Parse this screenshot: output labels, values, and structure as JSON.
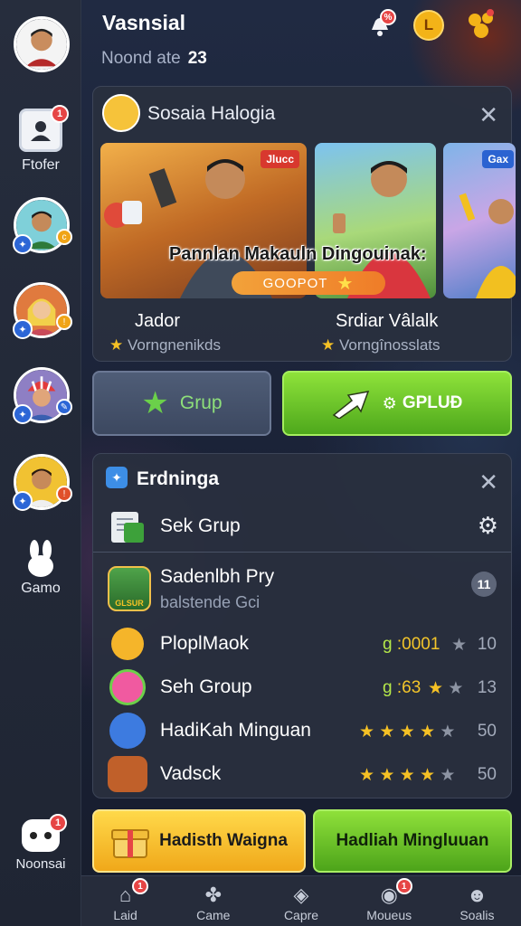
{
  "header": {
    "title": "Vasnsial",
    "subtitle_label": "Noond ate",
    "subtitle_value": "23",
    "notif_badge": "%"
  },
  "rail": {
    "items": [
      {
        "label": "Ftofer",
        "badge": "1"
      },
      {
        "label": "Gamo"
      },
      {
        "label": "Noonsai",
        "badge": "1"
      }
    ]
  },
  "featured": {
    "title": "Sosaia Halogia",
    "card1_tag": "Jlucc",
    "card3_tag": "Gax",
    "overlay_text": "Pannlan Makauln Dingouinak:",
    "badge_text": "GOOPOT",
    "captions": [
      {
        "name": "Jador",
        "sub": "Vorngnenikds"
      },
      {
        "name": "Srdiar Vâlalk",
        "sub": "Vorngînosslats"
      }
    ]
  },
  "actions": {
    "grup_label": "Grup",
    "gplup_label": "GPLUÐ"
  },
  "group_panel": {
    "title": "Erdninga",
    "sek_label": "Sek Grup",
    "rows": [
      {
        "name": "Sadenlbh Pry",
        "sub": "balstende Gci",
        "badge": "11",
        "icon_label": "GLSUR"
      },
      {
        "name": "PloplMaok",
        "value": ":0001",
        "num": "10",
        "stars": 0
      },
      {
        "name": "Seh Group",
        "value": ":63",
        "num": "13",
        "stars": 1
      },
      {
        "name": "HadiKah Minguan",
        "num": "50",
        "stars": 4
      },
      {
        "name": "Vadsck",
        "num": "50",
        "stars": 4
      }
    ]
  },
  "bottom_buttons": {
    "gift_label": "Hadisth Waigna",
    "hadiah_label": "Hadliah Mingluuan"
  },
  "nav": {
    "items": [
      {
        "label": "Laid",
        "icon": "home-icon",
        "badge": "1"
      },
      {
        "label": "Came",
        "icon": "puzzle-icon"
      },
      {
        "label": "Capre",
        "icon": "capture-icon"
      },
      {
        "label": "Moueus",
        "icon": "camera-icon",
        "badge": "1"
      },
      {
        "label": "Soalis",
        "icon": "people-icon"
      }
    ]
  },
  "colors": {
    "accent_green": "#8ee23a",
    "accent_yellow": "#ffd94a",
    "badge_red": "#e64545",
    "panel_bg": "#292f3e"
  }
}
